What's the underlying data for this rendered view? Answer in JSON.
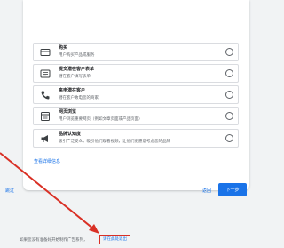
{
  "goals": [
    {
      "title": "购买",
      "desc": "用户购买产品或服务",
      "icon": "card-icon"
    },
    {
      "title": "提交潜在客户表单",
      "desc": "潜在客户填写表单",
      "icon": "form-icon"
    },
    {
      "title": "来电潜在客户",
      "desc": "潜在客户致电您的商家",
      "icon": "phone-icon"
    },
    {
      "title": "网页浏览",
      "desc": "用户浏览重要网页（例如文章页面或产品页面）",
      "icon": "webpage-icon"
    },
    {
      "title": "品牌认知度",
      "desc": "吸引广泛受众，吸引他们观看视频，让他们更愿意考虑您的品牌",
      "icon": "megaphone-icon"
    }
  ],
  "more_info_link": "查看详细信息",
  "skip_label": "跳过",
  "back_label": "返回",
  "next_label": "下一步",
  "footer": {
    "text": "如果您没有准备好开始制作广告系列，",
    "link": "请在此处退出"
  },
  "colors": {
    "accent": "#1a73e8",
    "highlight": "#d93025"
  }
}
